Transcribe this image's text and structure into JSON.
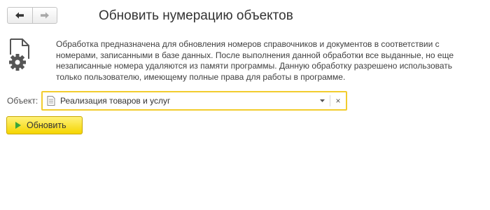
{
  "nav": {
    "back_icon": "arrow-left-icon",
    "forward_icon": "arrow-right-icon"
  },
  "header": {
    "title": "Обновить нумерацию объектов"
  },
  "info": {
    "icon": "document-gear-icon",
    "description": "Обработка предназначена для обновления номеров справочников и документов в соответствии с номерами, записанными в базе данных. После выполнения данной обработки все выданные, но еще незаписанные номера удаляются из памяти программы. Данную обработку разрешено использовать только пользователю, имеющему полные права для работы в программе."
  },
  "object_field": {
    "label": "Объект:",
    "value": "Реализация товаров и услуг",
    "value_icon": "document-icon",
    "dropdown_icon": "chevron-down-icon",
    "clear_glyph": "×",
    "focus_color": "#f2cc2e"
  },
  "actions": {
    "update_label": "Обновить",
    "update_icon": "play-icon",
    "update_color": "#f5d500"
  }
}
